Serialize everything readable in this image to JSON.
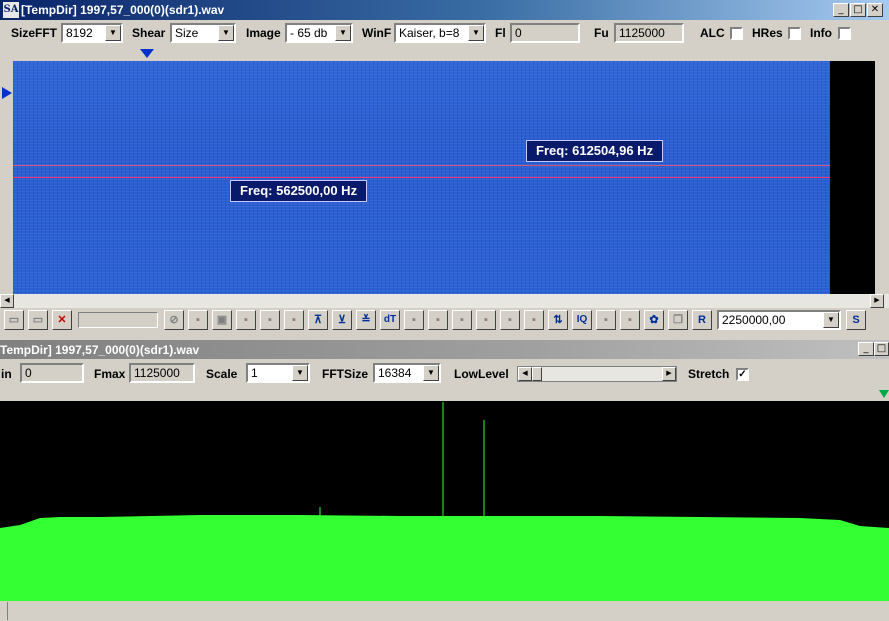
{
  "colors": {
    "titlebar_active": "#0a246a",
    "spectrogram": "#2c62d6",
    "spectrum_fill": "#33ff33",
    "freq_label_bg": "#0a1a6a",
    "marker_line": "#ff3070"
  },
  "window1": {
    "title": "[TempDir] 1997,57_000(0)(sdr1).wav",
    "app_icon_text": "SA",
    "buttons": {
      "minimize": "_",
      "maximize": "□",
      "close": "✕"
    },
    "controls": {
      "sizefft_label": "SizeFFT",
      "sizefft_value": "8192",
      "shear_label": "Shear",
      "shear_value": "Size",
      "image_label": "Image",
      "image_value": "- 65 db",
      "winf_label": "WinF",
      "winf_value": "Kaiser, b=8",
      "fl_label": "Fl",
      "fl_value": "0",
      "fu_label": "Fu",
      "fu_value": "1125000",
      "alc_label": "ALC",
      "hres_label": "HRes",
      "info_label": "Info"
    },
    "freq_labels": [
      "Freq: 612504,96 Hz",
      "Freq: 562500,00 Hz"
    ],
    "toolbar": {
      "sample_rate_value": "2250000,00",
      "dt_label": "dT",
      "iq_label": "IQ",
      "r_label": "R",
      "s_label": "S"
    }
  },
  "window2": {
    "title": "TempDir] 1997,57_000(0)(sdr1).wav",
    "buttons": {
      "minimize": "_",
      "maximize": "□"
    },
    "controls": {
      "fmin_label": "in",
      "fmin_value": "0",
      "fmax_label": "Fmax",
      "fmax_value": "1125000",
      "scale_label": "Scale",
      "scale_value": "1",
      "fftsize_label": "FFTSize",
      "fftsize_value": "16384",
      "lowlevel_label": "LowLevel",
      "stretch_label": "Stretch",
      "stretch_checked": true
    }
  }
}
